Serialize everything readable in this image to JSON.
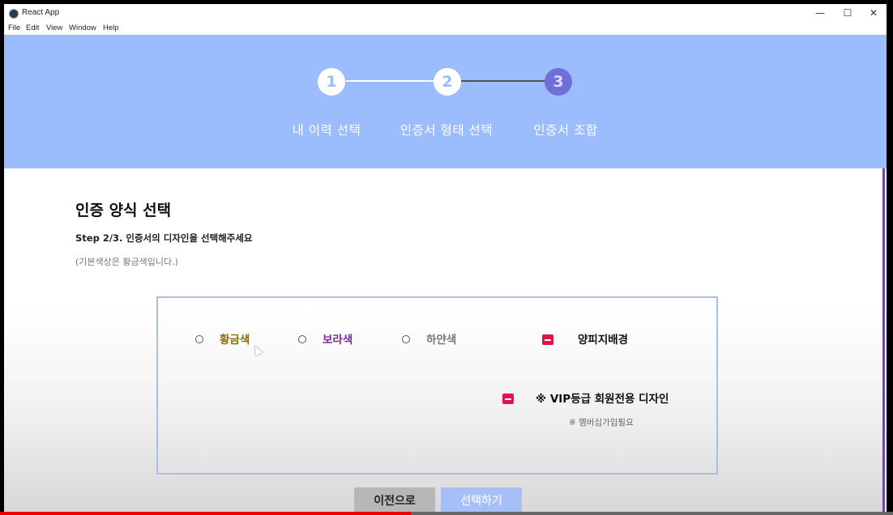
{
  "window": {
    "title": "React App",
    "controls": [
      "—",
      "☐",
      "✕"
    ]
  },
  "menu": [
    "File",
    "Edit",
    "View",
    "Window",
    "Help"
  ],
  "stepper": {
    "steps": [
      {
        "number": "1",
        "label": "내 이력 선택",
        "state": "completed"
      },
      {
        "number": "2",
        "label": "인증서 형태 선택",
        "state": "completed"
      },
      {
        "number": "3",
        "label": "인증서 조합",
        "state": "current"
      }
    ],
    "colors": {
      "band": "#9bbcfd",
      "active": "#6f6fd6",
      "done": "#ffffff",
      "line_done": "#ffffff",
      "line_pending": "#555555"
    }
  },
  "page": {
    "title": "인증 양식 선택",
    "step_desc": "Step 2/3. 인증서의 디자인을 선택해주세요",
    "hint": "(기본색상은 황금색입니다.)"
  },
  "options": {
    "colors": [
      {
        "label": "황금색",
        "color": "#8a6b00"
      },
      {
        "label": "보라색",
        "color": "#7a2f9a"
      },
      {
        "label": "하얀색",
        "color": "#777777"
      }
    ],
    "parchment_label": "양피지배경",
    "vip_label": "※ VIP등급 회원전용 디자인",
    "vip_note": "※ 멤버십가입필요"
  },
  "buttons": {
    "prev": "이전으로",
    "select": "선택하기"
  },
  "video_progress": 0.46
}
